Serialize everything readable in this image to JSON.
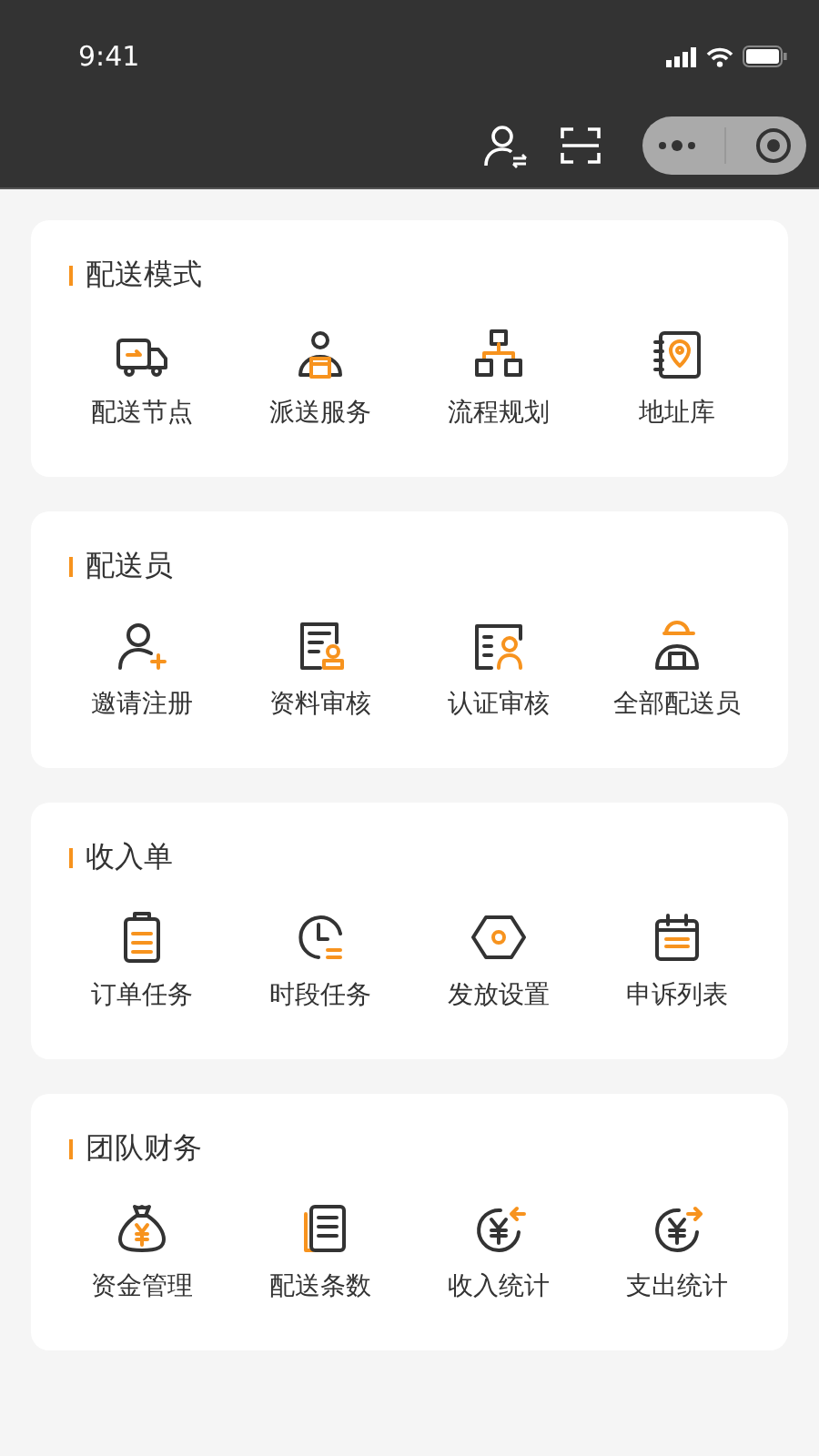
{
  "status_bar": {
    "time": "9:41"
  },
  "sections": [
    {
      "title": "配送模式",
      "items": [
        {
          "label": "配送节点"
        },
        {
          "label": "派送服务"
        },
        {
          "label": "流程规划"
        },
        {
          "label": "地址库"
        }
      ]
    },
    {
      "title": "配送员",
      "items": [
        {
          "label": "邀请注册"
        },
        {
          "label": "资料审核"
        },
        {
          "label": "认证审核"
        },
        {
          "label": "全部配送员"
        }
      ]
    },
    {
      "title": "收入单",
      "items": [
        {
          "label": "订单任务"
        },
        {
          "label": "时段任务"
        },
        {
          "label": "发放设置"
        },
        {
          "label": "申诉列表"
        }
      ]
    },
    {
      "title": "团队财务",
      "items": [
        {
          "label": "资金管理"
        },
        {
          "label": "配送条数"
        },
        {
          "label": "收入统计"
        },
        {
          "label": "支出统计"
        }
      ]
    }
  ]
}
